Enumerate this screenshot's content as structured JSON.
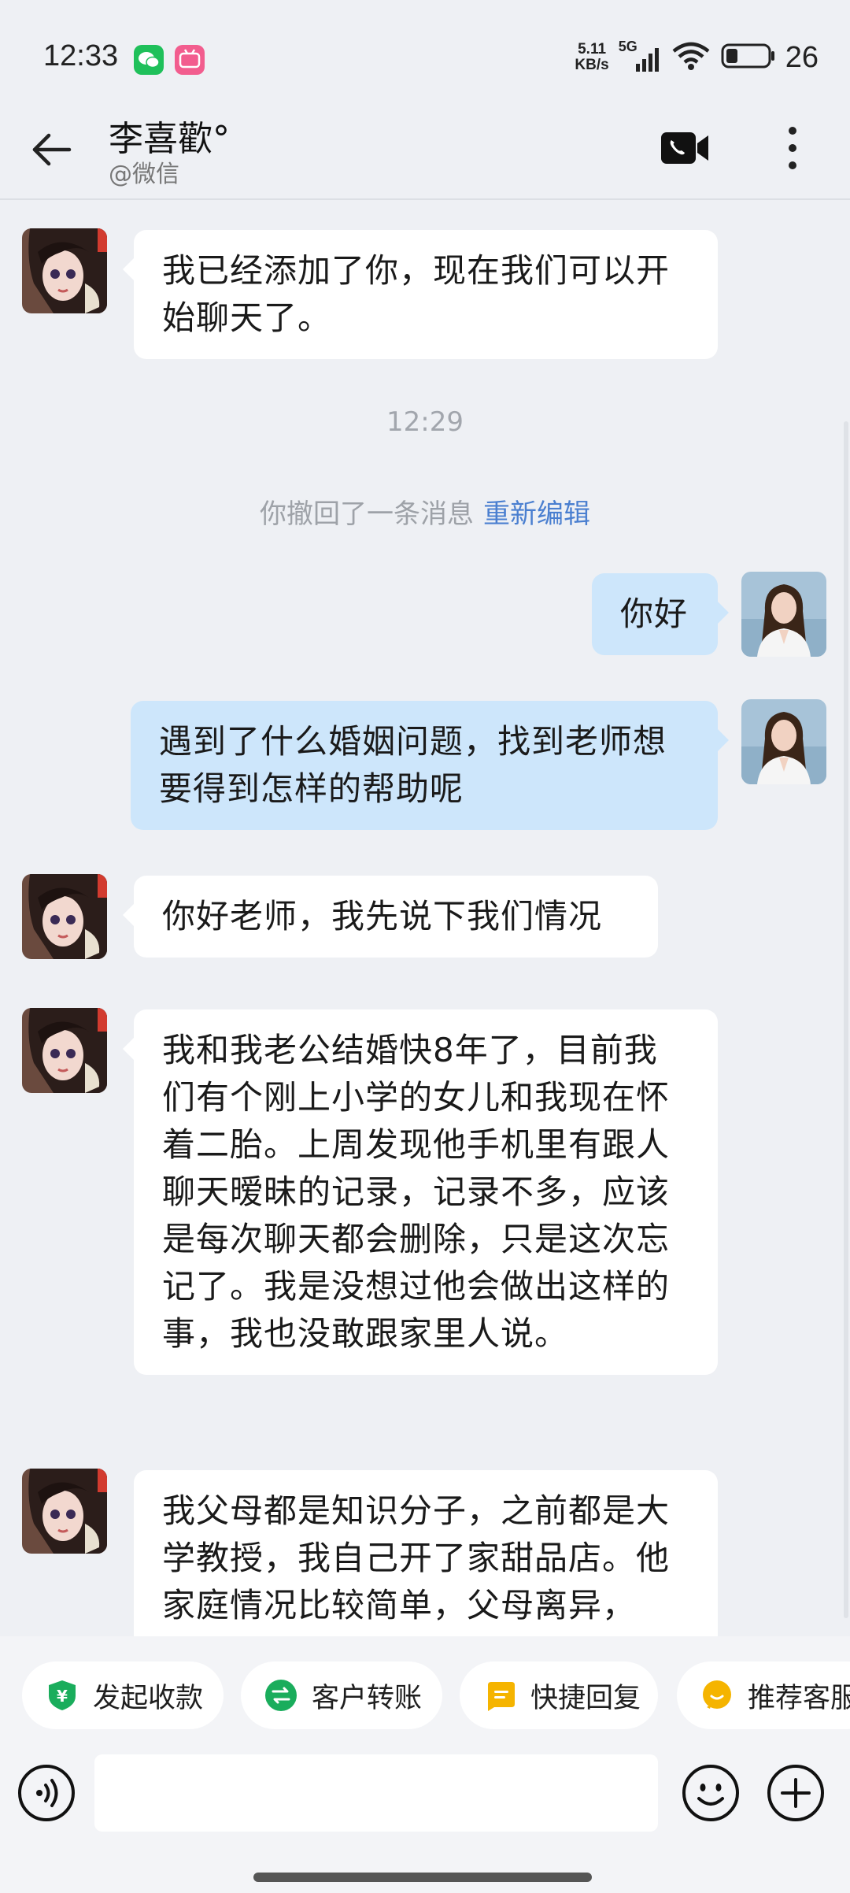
{
  "status_bar": {
    "time": "12:33",
    "net_speed_value": "5.11",
    "net_speed_unit": "KB/s",
    "signal_label": "5G",
    "battery": "26"
  },
  "header": {
    "title": "李喜歡°",
    "subtitle": "@微信"
  },
  "messages": [
    {
      "side": "in",
      "text": "我已经添加了你，现在我们可以开始聊天了。"
    },
    {
      "side": "out",
      "text": "你好"
    },
    {
      "side": "out",
      "text": "遇到了什么婚姻问题，找到老师想要得到怎样的帮助呢"
    },
    {
      "side": "in",
      "text": "你好老师，我先说下我们情况"
    },
    {
      "side": "in",
      "text": "我和我老公结婚快8年了，目前我们有个刚上小学的女儿和我现在怀着二胎。上周发现他手机里有跟人聊天暧昧的记录，记录不多，应该是每次聊天都会删除，只是这次忘记了。我是没想过他会做出这样的事，我也没敢跟家里人说。"
    },
    {
      "side": "in",
      "text": "我父母都是知识分子，之前都是大学教授，我自己开了家甜品店。他家庭情况比较简单，父母离异，"
    }
  ],
  "timestamp": "12:29",
  "recall": {
    "text": "你撤回了一条消息",
    "action": "重新编辑"
  },
  "quick_actions": [
    {
      "label": "发起收款",
      "icon": "receive-payment-icon",
      "color": "#1aad5c"
    },
    {
      "label": "客户转账",
      "icon": "transfer-icon",
      "color": "#1aad5c"
    },
    {
      "label": "快捷回复",
      "icon": "quick-reply-icon",
      "color": "#f5b400"
    },
    {
      "label": "推荐客服",
      "icon": "recommend-service-icon",
      "color": "#f5b400"
    }
  ],
  "input": {
    "value": "",
    "placeholder": ""
  },
  "colors": {
    "background": "#eef0f4",
    "incoming_bubble": "#ffffff",
    "outgoing_bubble": "#cde6fb",
    "link": "#4a7fd0"
  }
}
